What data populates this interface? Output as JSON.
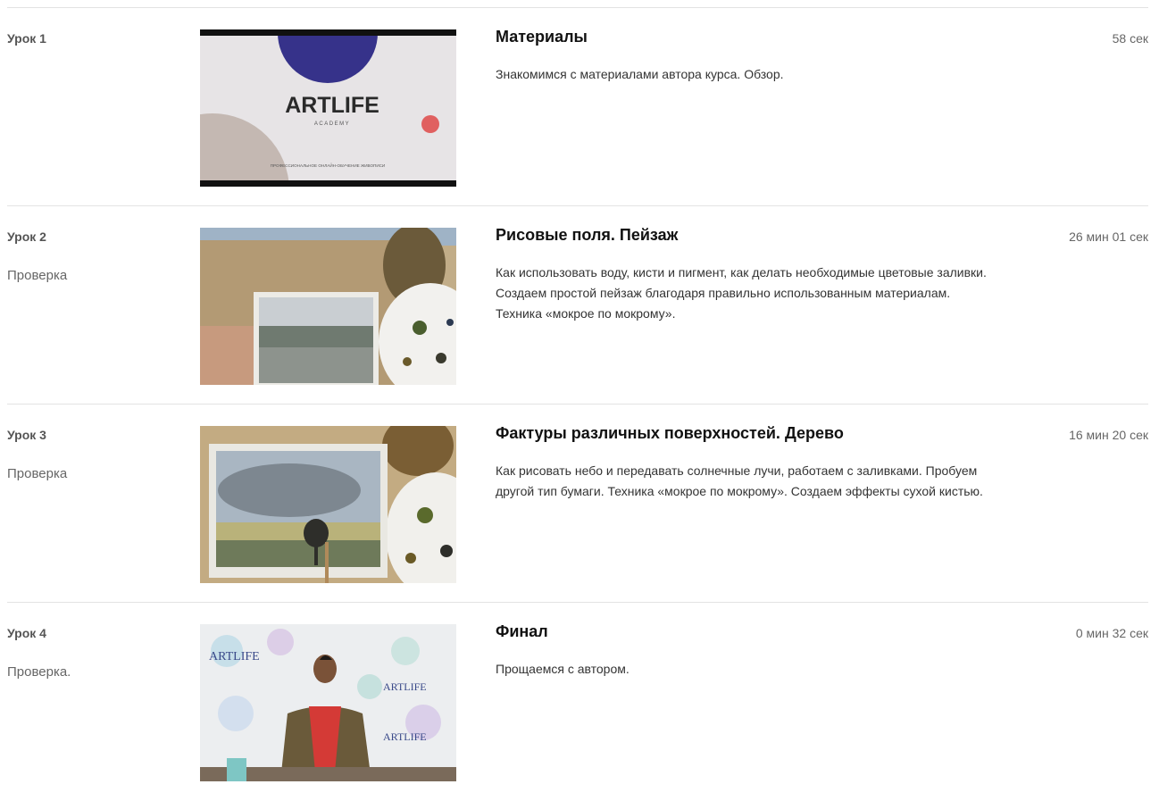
{
  "lessons": [
    {
      "number": "Урок 1",
      "status": "",
      "title": "Материалы",
      "description": "Знакомимся с материалами автора курса. Обзор.",
      "duration": "58 сек",
      "thumbnail": {
        "type": "artlife-cover",
        "logo": "ARTLIFE",
        "sub": "ACADEMY",
        "tagline": "ПРОФЕССИОНАЛЬНОЕ ОНЛАЙН-ОБУЧЕНИЕ ЖИВОПИСИ",
        "colors": {
          "bg": "#e7e4e6",
          "circle": "#36328a",
          "beige": "#c4b8b2",
          "dot": "#e06060"
        }
      }
    },
    {
      "number": "Урок 2",
      "status": "Проверка",
      "title": "Рисовые поля. Пейзаж",
      "description": "Как использовать воду,  кисти и пигмент, как делать необходимые цветовые заливки. Создаем простой пейзаж благодаря правильно использованным материалам. Техника «мокрое по мокрому».",
      "duration": "26 мин 01 сек",
      "thumbnail": {
        "type": "watercolor-landscape-photo"
      }
    },
    {
      "number": "Урок 3",
      "status": "Проверка",
      "title": "Фактуры различных поверхностей. Дерево",
      "description": "Как рисовать небо и передавать солнечные лучи, работаем с заливками. Пробуем другой тип бумаги. Техника «мокрое по мокрому». Создаем эффекты сухой кистью.",
      "duration": "16 мин 20 сек",
      "thumbnail": {
        "type": "watercolor-tree-photo"
      }
    },
    {
      "number": "Урок 4",
      "status": "Проверка.",
      "title": "Финал",
      "description": "Прощаемся с автором.",
      "duration": "0 мин 32 сек",
      "thumbnail": {
        "type": "author-photo",
        "backdrop_text": "ARTLIFE"
      }
    }
  ]
}
